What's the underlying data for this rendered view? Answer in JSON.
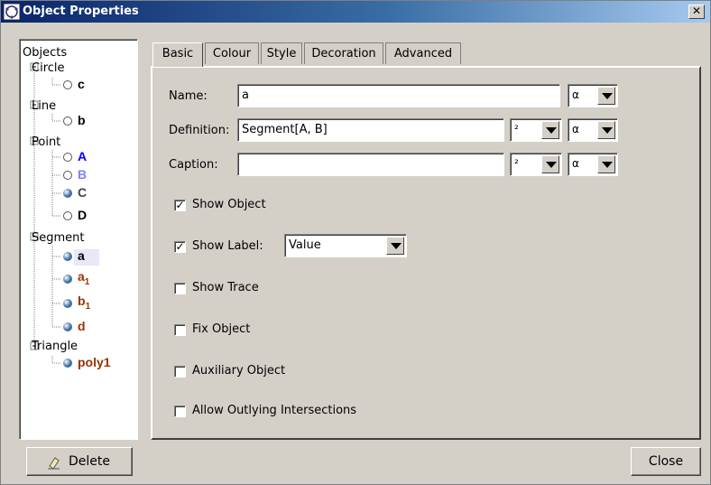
{
  "window": {
    "title": "Object Properties",
    "close_glyph": "✕"
  },
  "tree": {
    "root": "Objects",
    "categories": [
      {
        "label": "Circle",
        "items": [
          {
            "name": "c",
            "sub": "",
            "color": "#000000",
            "icon": "hollow-circle-icon"
          }
        ]
      },
      {
        "label": "Line",
        "items": [
          {
            "name": "b",
            "sub": "",
            "color": "#000000",
            "icon": "hollow-circle-icon"
          }
        ]
      },
      {
        "label": "Point",
        "items": [
          {
            "name": "A",
            "sub": "",
            "color": "#0000ff",
            "icon": "hollow-circle-icon"
          },
          {
            "name": "B",
            "sub": "",
            "color": "#7f7fff",
            "icon": "hollow-circle-icon"
          },
          {
            "name": "C",
            "sub": "",
            "color": "#444444",
            "icon": "filled-sphere-icon"
          },
          {
            "name": "D",
            "sub": "",
            "color": "#000000",
            "icon": "hollow-circle-icon"
          }
        ]
      },
      {
        "label": "Segment",
        "items": [
          {
            "name": "a",
            "sub": "",
            "color": "#000000",
            "icon": "filled-sphere-icon",
            "selected": true
          },
          {
            "name": "a",
            "sub": "1",
            "color": "#993300",
            "icon": "filled-sphere-icon"
          },
          {
            "name": "b",
            "sub": "1",
            "color": "#993300",
            "icon": "filled-sphere-icon"
          },
          {
            "name": "d",
            "sub": "",
            "color": "#993300",
            "icon": "filled-sphere-icon"
          }
        ]
      },
      {
        "label": "Triangle",
        "items": [
          {
            "name": "poly1",
            "sub": "",
            "color": "#993300",
            "icon": "filled-sphere-icon"
          }
        ]
      }
    ]
  },
  "tabs": [
    "Basic",
    "Colour",
    "Style",
    "Decoration",
    "Advanced"
  ],
  "basic": {
    "name_label": "Name:",
    "name_value": "a",
    "definition_label": "Definition:",
    "definition_value": "Segment[A, B]",
    "caption_label": "Caption:",
    "caption_value": "",
    "superscript_glyph": "²",
    "alpha_glyph": "α",
    "show_object": "Show Object",
    "show_label": "Show Label:",
    "show_label_value": "Value",
    "show_trace": "Show Trace",
    "fix_object": "Fix Object",
    "auxiliary_object": "Auxiliary Object",
    "allow_outlying": "Allow Outlying Intersections",
    "check_glyph": "✓"
  },
  "checks": {
    "show_object": true,
    "show_label": true,
    "show_trace": false,
    "fix_object": false,
    "auxiliary_object": false,
    "allow_outlying": false
  },
  "buttons": {
    "delete": "Delete",
    "close": "Close"
  }
}
